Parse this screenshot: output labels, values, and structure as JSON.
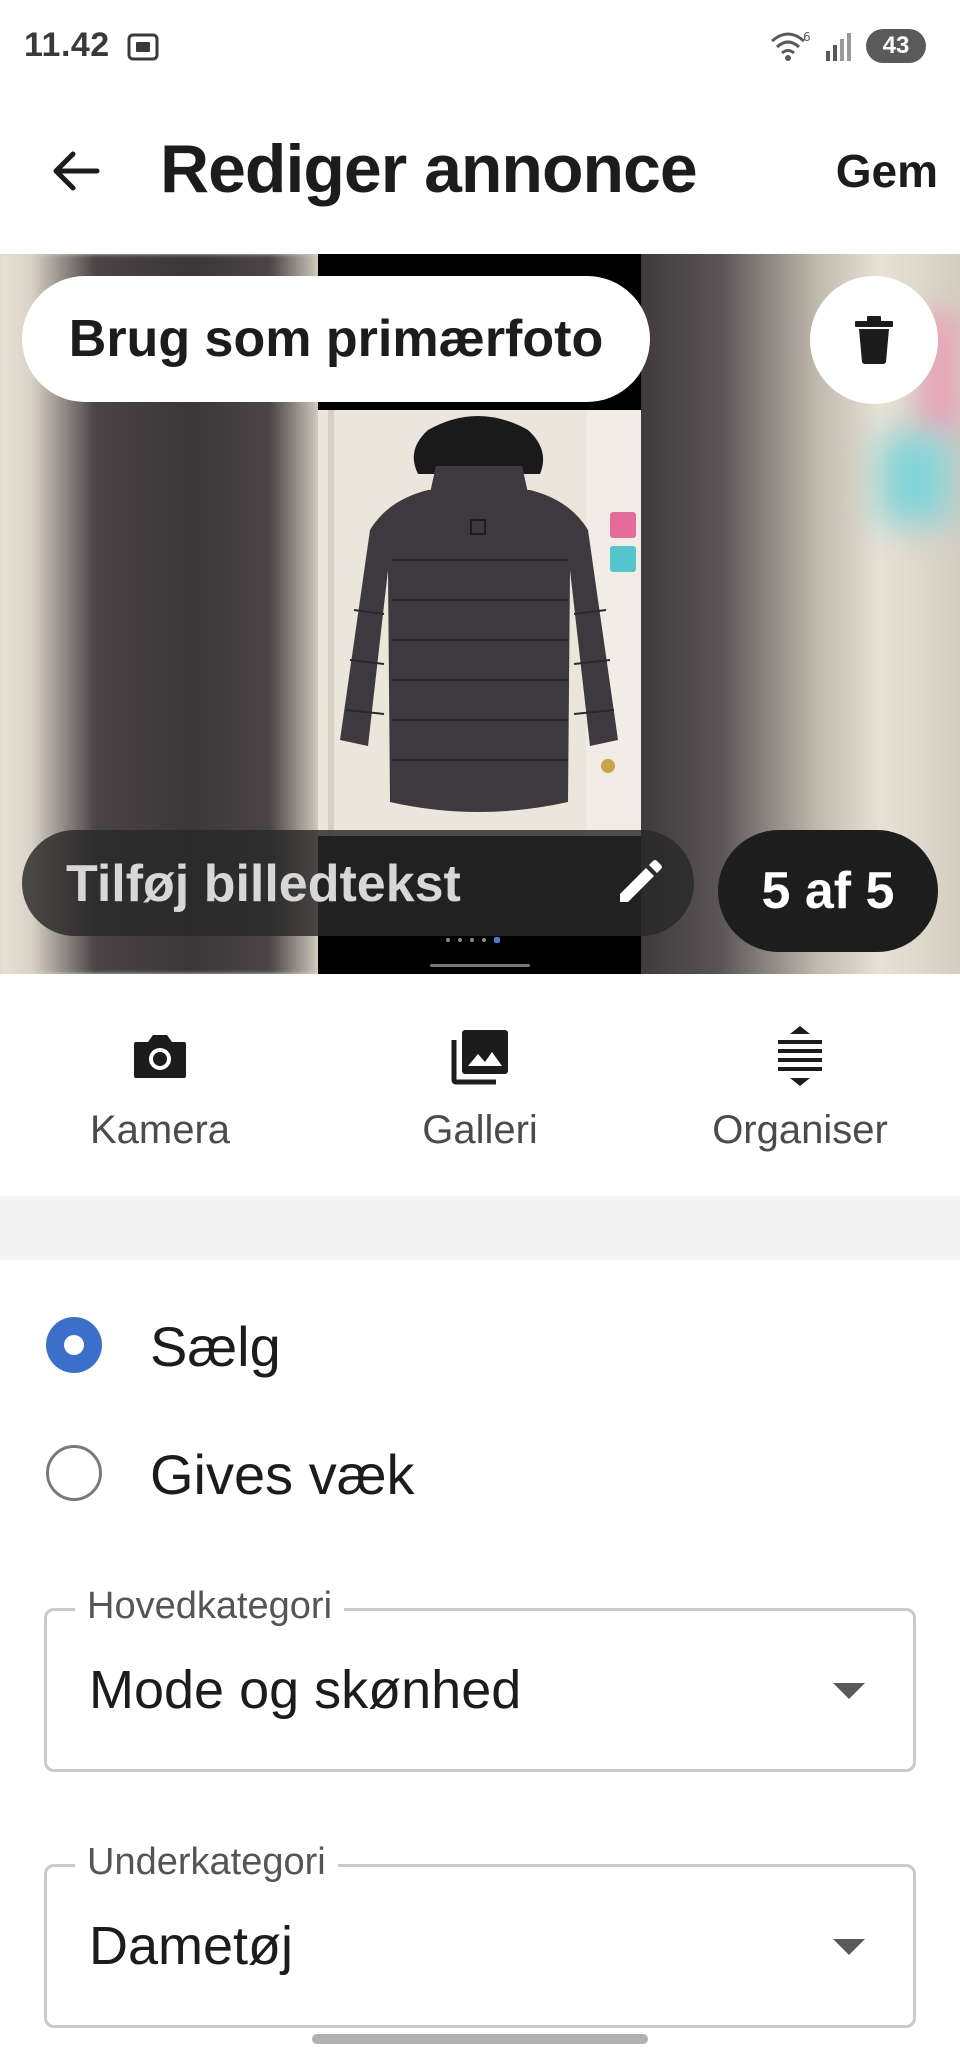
{
  "status_bar": {
    "time": "11.42",
    "battery": "43",
    "icons": [
      "screenshot-icon",
      "wifi-icon",
      "signal-icon",
      "battery-icon"
    ]
  },
  "app_bar": {
    "title": "Rediger annonce",
    "save_label": "Gem",
    "back_icon": "arrow-left-icon"
  },
  "photo": {
    "primary_button": "Brug som primærfoto",
    "delete_icon": "trash-icon",
    "caption_placeholder": "Tilføj billedtekst",
    "caption_icon": "pencil-icon",
    "counter": "5 af 5",
    "current_index": 5,
    "total": 5
  },
  "actions": [
    {
      "label": "Kamera",
      "icon": "camera-icon"
    },
    {
      "label": "Galleri",
      "icon": "gallery-icon"
    },
    {
      "label": "Organiser",
      "icon": "reorder-icon"
    }
  ],
  "listing_type": {
    "options": [
      {
        "label": "Sælg",
        "selected": true
      },
      {
        "label": "Gives væk",
        "selected": false
      }
    ]
  },
  "fields": {
    "main_category": {
      "label": "Hovedkategori",
      "value": "Mode og skønhed"
    },
    "sub_category": {
      "label": "Underkategori",
      "value": "Dametøj"
    }
  },
  "colors": {
    "accent": "#3b6fc9",
    "text": "#1c1c1c",
    "pill_dark": "#1d1d1d"
  }
}
